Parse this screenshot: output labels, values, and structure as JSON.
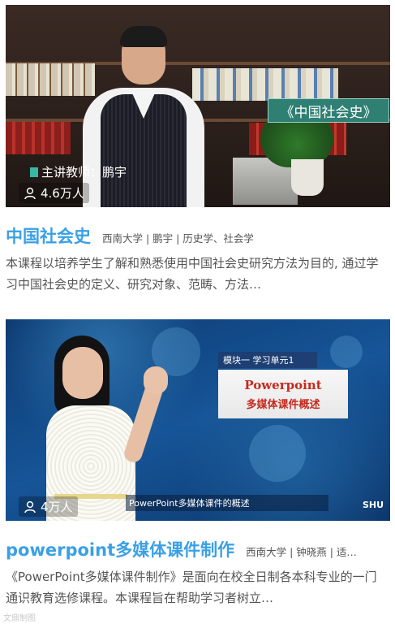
{
  "courses": [
    {
      "title": "中国社会史",
      "meta": "西南大学 | 鹏宇 | 历史学、社会学",
      "description": "本课程以培养学生了解和熟悉使用中国社会史研究方法为目的, 通过学习中国社会史的定义、研究对象、范畴、方法…",
      "views": "4.6万人",
      "thumbnail": {
        "plaque_text": "《中国社会史》",
        "lecturer_text": "主讲教师：鹏宇"
      }
    },
    {
      "title": "powerpoint多媒体课件制作",
      "meta": "西南大学 | 钟晓燕 | 适…",
      "description": "《PowerPoint多媒体课件制作》是面向在校全日制各本科专业的一门通识教育选修课程。本课程旨在帮助学习者树立…",
      "views": "4万人",
      "thumbnail": {
        "module_header": "模块一 学习单元1",
        "box_line1": "Powerpoint",
        "box_line2": "多媒体课件概述",
        "caption": "PowerPoint多媒体课件的概述",
        "logo_text": "SHU"
      }
    }
  ],
  "icons": {
    "views": "person-icon"
  },
  "colors": {
    "title": "#3aa0e5",
    "text": "#555555"
  },
  "watermark": "文鼎制图"
}
